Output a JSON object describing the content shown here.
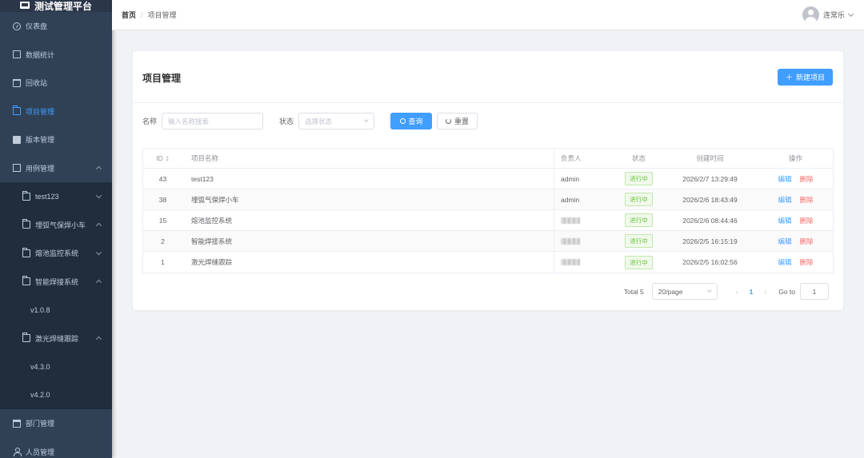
{
  "app": {
    "title": "测试管理平台"
  },
  "sidebar": {
    "items": [
      {
        "label": "仪表盘",
        "icon": "dashboard-icon"
      },
      {
        "label": "数据统计",
        "icon": "chart-icon"
      },
      {
        "label": "回收站",
        "icon": "trash-icon"
      },
      {
        "label": "项目管理",
        "icon": "folder-icon",
        "active": true
      },
      {
        "label": "版本管理",
        "icon": "monitor-icon"
      },
      {
        "label": "用例管理",
        "icon": "document-icon",
        "expanded": true
      },
      {
        "label": "test123",
        "icon": "folder-icon"
      },
      {
        "label": "埋弧气保焊小车",
        "icon": "folder-icon"
      },
      {
        "label": "熔池监控系统",
        "icon": "folder-icon"
      },
      {
        "label": "智能焊接系统",
        "icon": "folder-icon"
      },
      {
        "label": "v1.0.8"
      },
      {
        "label": "激光焊缝跟踪",
        "icon": "folder-icon"
      },
      {
        "label": "v4.3.0"
      },
      {
        "label": "v4.2.0"
      },
      {
        "label": "部门管理",
        "icon": "building-icon"
      },
      {
        "label": "人员管理",
        "icon": "user-icon"
      }
    ]
  },
  "header": {
    "breadcrumb_home": "首页",
    "breadcrumb_sep": "/",
    "breadcrumb_current": "项目管理",
    "username": "连常乐"
  },
  "page": {
    "title": "项目管理",
    "new_button": "新建项目",
    "filters": {
      "name_label": "名称",
      "name_placeholder": "输入名称搜索",
      "status_label": "状态",
      "status_placeholder": "选择状态",
      "query_button": "查询",
      "reset_button": "重置"
    },
    "table": {
      "columns": [
        "ID",
        "项目名称",
        "负责人",
        "状态",
        "创建时间",
        "操作"
      ],
      "rows": [
        {
          "id": "43",
          "name": "test123",
          "owner": "admin",
          "status": "进行中",
          "created": "2026/2/7 13:29:49",
          "edit": "编辑",
          "delete": "删除"
        },
        {
          "id": "38",
          "name": "埋弧气保焊小车",
          "owner": "admin",
          "status": "进行中",
          "created": "2026/2/6 18:43:49",
          "edit": "编辑",
          "delete": "删除"
        },
        {
          "id": "15",
          "name": "熔池监控系统",
          "owner": "",
          "status": "进行中",
          "created": "2026/2/6 08:44:46",
          "edit": "编辑",
          "delete": "删除"
        },
        {
          "id": "2",
          "name": "智能焊接系统",
          "owner": "",
          "status": "进行中",
          "created": "2026/2/5 16:15:19",
          "edit": "编辑",
          "delete": "删除"
        },
        {
          "id": "1",
          "name": "激光焊缝跟踪",
          "owner": "",
          "status": "进行中",
          "created": "2026/2/5 16:02:56",
          "edit": "编辑",
          "delete": "删除"
        }
      ]
    },
    "pagination": {
      "total": "Total 5",
      "page_size": "20/page",
      "current_page": "1",
      "goto_label": "Go to",
      "goto_value": "1"
    }
  },
  "colors": {
    "primary": "#409eff",
    "sidebar_bg": "#304156",
    "success": "#67c23a",
    "danger": "#f56c6c"
  }
}
